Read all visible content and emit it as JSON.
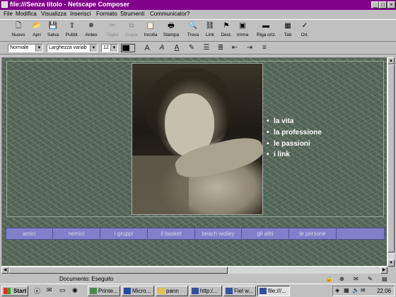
{
  "window": {
    "title": "file:///Senza titolo - Netscape Composer",
    "controls": [
      "minimize",
      "maximize",
      "close"
    ]
  },
  "menubar": {
    "items": [
      "File",
      "Modifica",
      "Visualizza",
      "Inserisci",
      "Formato",
      "Strumenti",
      "Communicator",
      "?"
    ]
  },
  "toolbar": {
    "buttons": [
      {
        "label": "Nuovo",
        "icon": "new-icon",
        "enabled": true
      },
      {
        "label": "Apri",
        "icon": "open-icon",
        "enabled": true
      },
      {
        "label": "Salva",
        "icon": "save-icon",
        "enabled": true
      },
      {
        "label": "Pubbl.",
        "icon": "publish-icon",
        "enabled": true
      },
      {
        "label": "Anteo",
        "icon": "preview-icon",
        "enabled": true
      },
      {
        "label": "Taglia",
        "icon": "cut-icon",
        "enabled": false
      },
      {
        "label": "Copia",
        "icon": "copy-icon",
        "enabled": false
      },
      {
        "label": "Incolla",
        "icon": "paste-icon",
        "enabled": true
      },
      {
        "label": "Stampa",
        "icon": "print-icon",
        "enabled": true
      },
      {
        "label": "Trova",
        "icon": "find-icon",
        "enabled": true
      },
      {
        "label": "Link",
        "icon": "link-icon",
        "enabled": true
      },
      {
        "label": "Dest.",
        "icon": "target-icon",
        "enabled": true
      },
      {
        "label": "Imma",
        "icon": "image-icon",
        "enabled": true
      },
      {
        "label": "Riga oriz.",
        "icon": "hrule-icon",
        "enabled": true
      },
      {
        "label": "Tab",
        "icon": "table-icon",
        "enabled": true
      },
      {
        "label": "Ort.",
        "icon": "spell-icon",
        "enabled": true
      }
    ]
  },
  "formatbar": {
    "paragraph_style": "Normale",
    "font": "Larghezza variab",
    "font_size": "12",
    "text_color": "#000000",
    "buttons": [
      "font-size-decrease-icon",
      "italic-a-icon",
      "underline-a-icon",
      "clear-styles-icon",
      "bullet-list-icon",
      "numbered-list-icon",
      "outdent-icon",
      "indent-icon",
      "align-icon"
    ]
  },
  "document": {
    "links": [
      "la vita",
      "la professione",
      "le passioni",
      "i link"
    ],
    "nav_buttons": [
      "amici",
      "nemici",
      "i gruppi",
      "il basket",
      "beach wolley",
      "gli altri",
      "le persone",
      ""
    ],
    "colors": {
      "nav_bg": "#8080c8",
      "nav_text": "#d6d6ee",
      "page_bg": "#556858"
    }
  },
  "statusbar": {
    "text": "Documento: Eseguito"
  },
  "taskbar": {
    "start_label": "Start",
    "buttons": [
      {
        "label": "Printe...",
        "active": false
      },
      {
        "label": "Micro...",
        "active": false
      },
      {
        "label": "pann",
        "active": false
      },
      {
        "label": "http:/...",
        "active": false
      },
      {
        "label": "Fiel w...",
        "active": false
      },
      {
        "label": "file:///...",
        "active": true
      }
    ],
    "clock": "22.06"
  }
}
